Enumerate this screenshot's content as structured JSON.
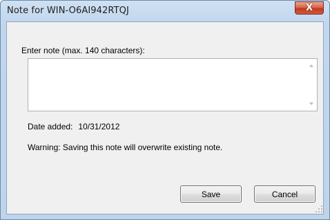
{
  "window": {
    "title": "Note for WIN-O6AI942RTQJ",
    "close_symbol": "X"
  },
  "form": {
    "note_label": "Enter note (max. 140 characters):",
    "note_value": "",
    "date_label": "Date added:",
    "date_value": "10/31/2012",
    "warning": "Warning: Saving this note will overwrite existing note."
  },
  "buttons": {
    "save_label": "Save",
    "cancel_label": "Cancel"
  },
  "icons": {
    "close": "close-icon",
    "scroll_up": "scroll-up-icon",
    "scroll_down": "scroll-down-icon",
    "resize_grip": "resize-grip-icon"
  },
  "colors": {
    "title_bar": "#c2d7ee",
    "close_button": "#c4391d",
    "client_background": "#f0f0f0"
  }
}
